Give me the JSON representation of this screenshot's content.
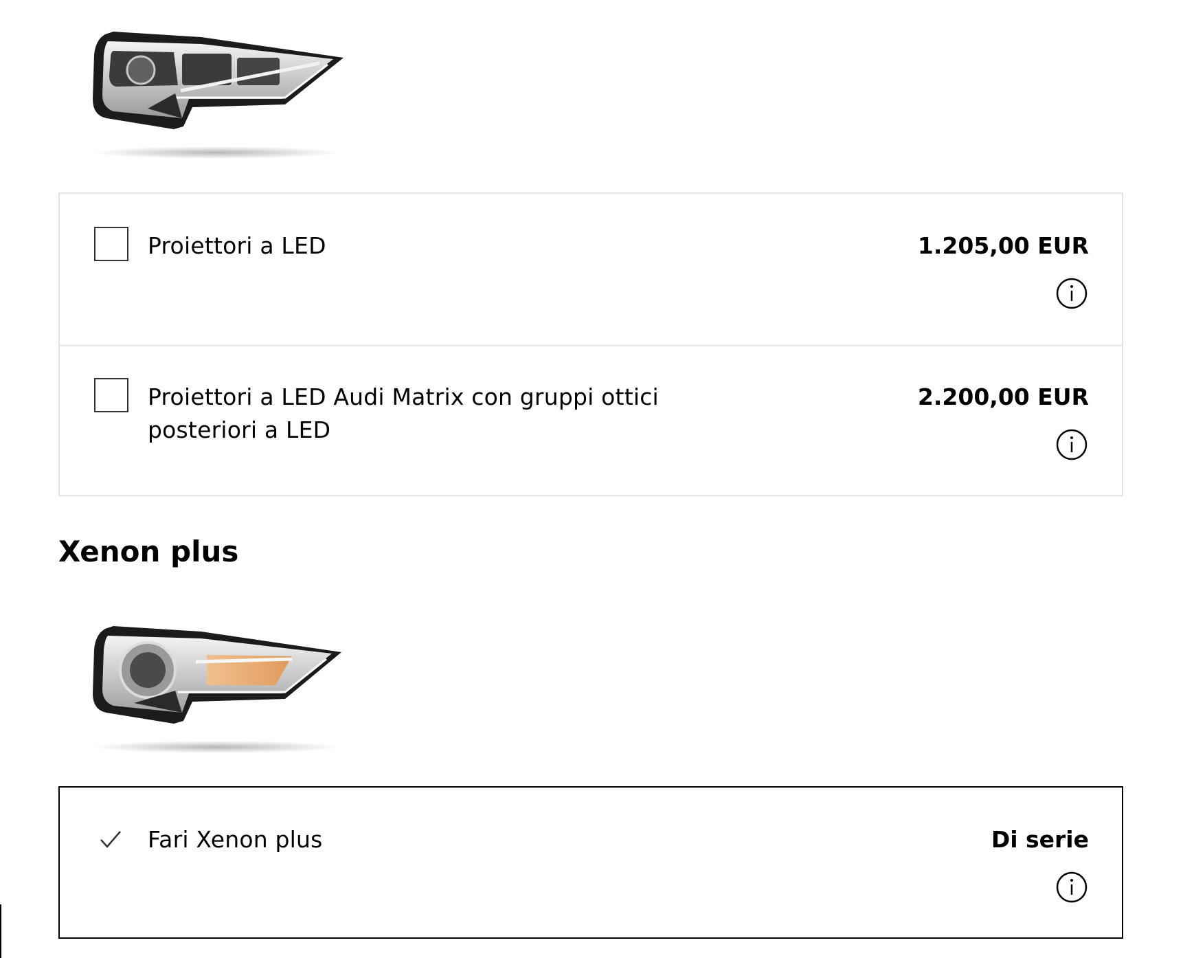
{
  "led_group": {
    "options": [
      {
        "label": "Proiettori a LED",
        "price": "1.205,00 EUR",
        "selected": false
      },
      {
        "label": "Proiettori a LED Audi Matrix con gruppi ottici posteriori a LED",
        "price": "2.200,00 EUR",
        "selected": false
      }
    ]
  },
  "xenon_section": {
    "title": "Xenon plus",
    "options": [
      {
        "label": "Fari Xenon plus",
        "price": "Di serie",
        "included": true
      }
    ]
  },
  "icons": {
    "info": "info-circle-icon",
    "check": "checkmark-icon"
  },
  "colors": {
    "text": "#000000",
    "border_light": "#e3e3e3",
    "border_selected": "#000000",
    "xenon_accent": "#e0a066"
  }
}
